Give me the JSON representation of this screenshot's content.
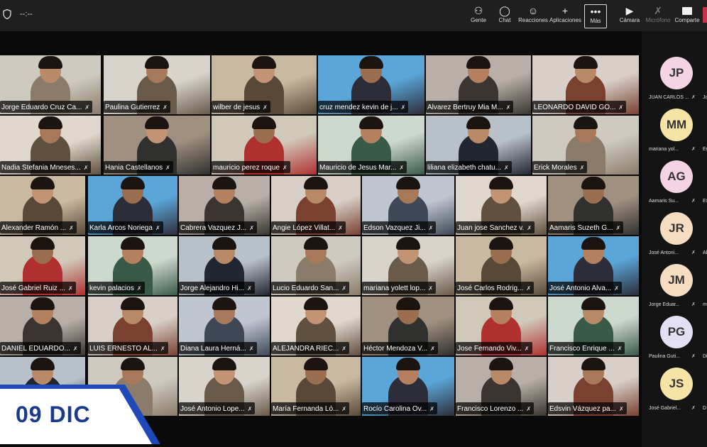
{
  "meeting": {
    "timer": "--:--"
  },
  "toolbar": {
    "people": "Gente",
    "chat": "Chat",
    "reactions": "Reacciones",
    "apps": "Aplicaciones",
    "more": "Más",
    "camera": "Cámara",
    "microphone": "Micrófono",
    "share": "Comparte"
  },
  "colors": {
    "toolbar_bg": "#1f1f1f",
    "leave_red": "#c4314b",
    "badge_blue": "#1a3a8a",
    "avatar_pink": "#f4d4e4",
    "avatar_yellow": "#f6e3a6",
    "avatar_peach": "#f6dcc0",
    "avatar_lilac": "#e4e0f4"
  },
  "participants": [
    [
      "Jorge Eduardo Cruz Ca...",
      "Paulina Gutierrez",
      "wilber de jesus",
      "cruz mendez kevin de j...",
      "Alvarez Bertruy Mia M...",
      "LEONARDO DAVID GO..."
    ],
    [
      "Nadia Stefania Mneses...",
      "Hania Castellanos",
      "mauricio perez roque",
      "Mauricio de Jesus Mar...",
      "liliana elizabeth chatu...",
      "Erick Morales"
    ],
    [
      "Alexander Ramón ...",
      "Karla Arcos Noriega",
      "Cabrera Vazquez J...",
      "Angie López Villat...",
      "Edson Vazquez Ji...",
      "Juan jose Sanchez v.",
      "Aamaris Suzeth G..."
    ],
    [
      "José Gabriel Ruiz ...",
      "kevin palacios",
      "Jorge Alejandro Hi...",
      "Lucio Eduardo San...",
      "mariana yolett lop...",
      "José Carlos Rodrig...",
      "José Antonio Alva..."
    ],
    [
      "DANIEL EDUARDO...",
      "LUIS ERNESTO AL...",
      "Diana Laura Herná...",
      "ALEJANDRA RIEC...",
      "Héctor Mendoza V...",
      "Jose Fernando Viv...",
      "Francisco Enrique ..."
    ],
    [
      "",
      "",
      "José Antonio Lope...",
      "María Fernanda Ló...",
      "Rocío Carolina Ov...",
      "Francisco Lorenzo ...",
      "Edsvin Vázquez pa..."
    ]
  ],
  "badge": {
    "date": "09 DIC"
  },
  "side_panel": [
    {
      "initials": "JP",
      "name": "JUAN CARLOS ...",
      "next": "Jo"
    },
    {
      "initials": "MM",
      "name": "mariana yol...",
      "next": "Er"
    },
    {
      "initials": "AG",
      "name": "Aamaris Su...",
      "next": "Ex"
    },
    {
      "initials": "JR",
      "name": "José Antoni...",
      "next": "Al"
    },
    {
      "initials": "JM",
      "name": "Jorge Eduar...",
      "next": "m"
    },
    {
      "initials": "PG",
      "name": "Paulina Guti...",
      "next": "Di"
    },
    {
      "initials": "JS",
      "name": "José Gabriel...",
      "next": "D"
    }
  ]
}
